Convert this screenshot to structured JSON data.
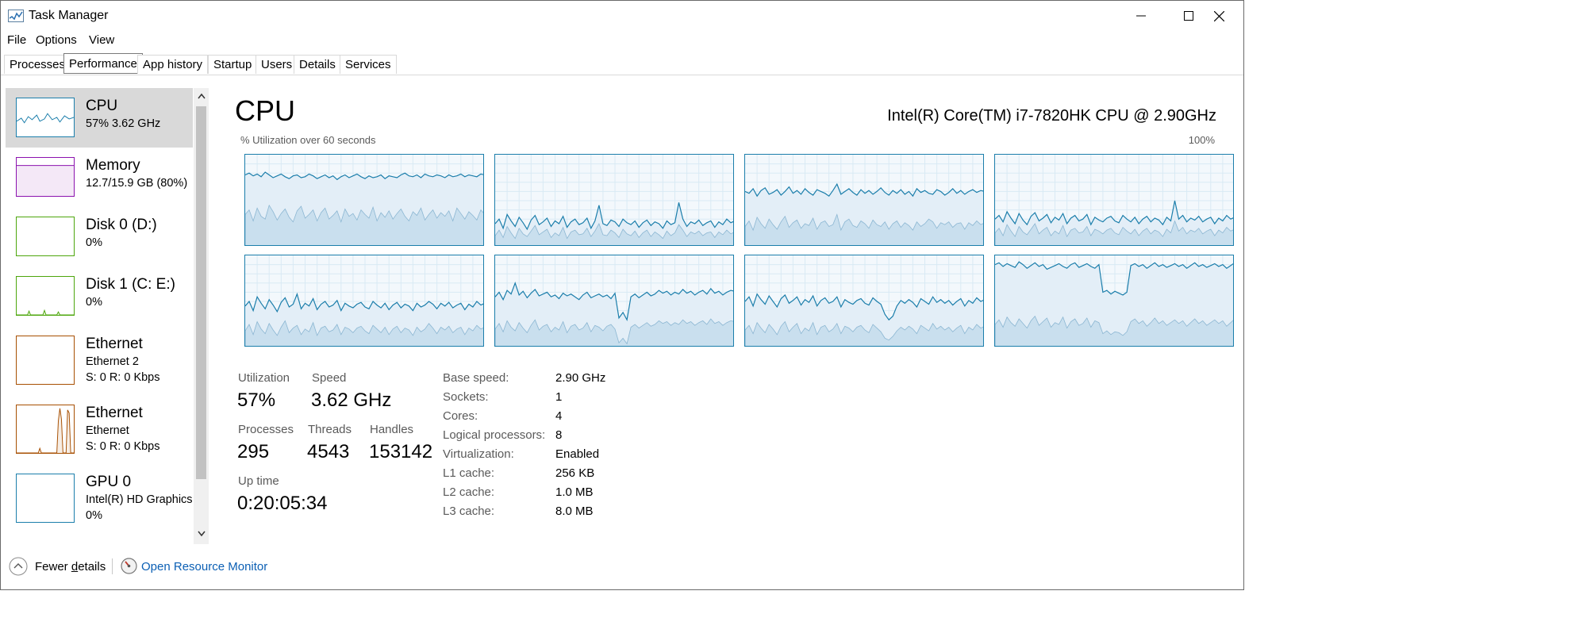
{
  "window": {
    "title": "Task Manager"
  },
  "menu": [
    "File",
    "Options",
    "View"
  ],
  "tabs": [
    "Processes",
    "Performance",
    "App history",
    "Startup",
    "Users",
    "Details",
    "Services"
  ],
  "active_tab": "Performance",
  "sidebar": [
    {
      "title": "CPU",
      "sub1": "57%  3.62 GHz",
      "sub2": "",
      "color": "#1b7eab",
      "selected": true
    },
    {
      "title": "Memory",
      "sub1": "12.7/15.9 GB (80%)",
      "sub2": "",
      "color": "#8b12ae",
      "selected": false
    },
    {
      "title": "Disk 0 (D:)",
      "sub1": "0%",
      "sub2": "",
      "color": "#4da60c",
      "selected": false
    },
    {
      "title": "Disk 1 (C: E:)",
      "sub1": "0%",
      "sub2": "",
      "color": "#4da60c",
      "selected": false
    },
    {
      "title": "Ethernet",
      "sub1": "Ethernet 2",
      "sub2": "S: 0  R: 0 Kbps",
      "color": "#a74f01",
      "selected": false
    },
    {
      "title": "Ethernet",
      "sub1": "Ethernet",
      "sub2": "S: 0  R: 0 Kbps",
      "color": "#a74f01",
      "selected": false
    },
    {
      "title": "GPU 0",
      "sub1": "Intel(R) HD Graphics",
      "sub2": "0%",
      "color": "#1b7eab",
      "selected": false
    }
  ],
  "cpu": {
    "title": "CPU",
    "model": "Intel(R) Core(TM) i7-7820HK CPU @ 2.90GHz",
    "graph_caption": "% Utilization over 60 seconds",
    "graph_max": "100%",
    "stats": {
      "utilization_label": "Utilization",
      "utilization": "57%",
      "speed_label": "Speed",
      "speed": "3.62 GHz",
      "processes_label": "Processes",
      "processes": "295",
      "threads_label": "Threads",
      "threads": "4543",
      "handles_label": "Handles",
      "handles": "153142",
      "uptime_label": "Up time",
      "uptime": "0:20:05:34"
    },
    "info": [
      {
        "label": "Base speed:",
        "value": "2.90 GHz"
      },
      {
        "label": "Sockets:",
        "value": "1"
      },
      {
        "label": "Cores:",
        "value": "4"
      },
      {
        "label": "Logical processors:",
        "value": "8"
      },
      {
        "label": "Virtualization:",
        "value": "Enabled"
      },
      {
        "label": "L1 cache:",
        "value": "256 KB"
      },
      {
        "label": "L2 cache:",
        "value": "1.0 MB"
      },
      {
        "label": "L3 cache:",
        "value": "8.0 MB"
      }
    ],
    "graph_color": "#1b7eab",
    "cores": [
      {
        "util": [
          78,
          80,
          77,
          79,
          76,
          81,
          78,
          75,
          77,
          79,
          76,
          74,
          77,
          78,
          75,
          76,
          79,
          77,
          74,
          76,
          78,
          75,
          77,
          73,
          76,
          78,
          75,
          77,
          79,
          76,
          74,
          77,
          75,
          76,
          78,
          74,
          77,
          76,
          75,
          78,
          80,
          77,
          76,
          78,
          75,
          79,
          77,
          76,
          78,
          77,
          75,
          78,
          76,
          77,
          79,
          76,
          78,
          77,
          76,
          79,
          78
        ],
        "kernel": [
          35,
          40,
          28,
          42,
          33,
          30,
          45,
          38,
          29,
          36,
          41,
          32,
          27,
          39,
          44,
          31,
          35,
          40,
          28,
          37,
          42,
          30,
          34,
          39,
          27,
          41,
          33,
          36,
          29,
          40,
          35,
          31,
          43,
          28,
          37,
          32,
          39,
          30,
          36,
          41,
          33,
          28,
          38,
          34,
          42,
          29,
          35,
          40,
          31,
          37,
          33,
          39,
          28,
          42,
          36,
          30,
          38,
          34,
          29,
          40,
          35
        ]
      },
      {
        "util": [
          25,
          30,
          20,
          35,
          28,
          22,
          32,
          26,
          19,
          29,
          34,
          24,
          27,
          31,
          22,
          28,
          25,
          33,
          21,
          27,
          30,
          24,
          26,
          31,
          20,
          28,
          45,
          25,
          23,
          29,
          27,
          22,
          30,
          26,
          24,
          28,
          21,
          26,
          29,
          23,
          27,
          25,
          20,
          28,
          24,
          26,
          48,
          30,
          22,
          27,
          25,
          29,
          23,
          26,
          28,
          21,
          27,
          24,
          30,
          26,
          28
        ],
        "kernel": [
          12,
          18,
          10,
          22,
          15,
          9,
          20,
          14,
          11,
          17,
          23,
          13,
          16,
          19,
          10,
          15,
          12,
          21,
          9,
          16,
          18,
          13,
          14,
          20,
          11,
          17,
          25,
          13,
          12,
          18,
          15,
          10,
          19,
          14,
          12,
          17,
          10,
          15,
          18,
          11,
          16,
          13,
          9,
          17,
          12,
          15,
          24,
          18,
          11,
          16,
          14,
          17,
          12,
          15,
          16,
          10,
          16,
          13,
          18,
          14,
          16
        ]
      },
      {
        "util": [
          60,
          58,
          63,
          55,
          61,
          64,
          57,
          59,
          62,
          56,
          60,
          65,
          58,
          61,
          57,
          63,
          59,
          56,
          62,
          60,
          58,
          55,
          61,
          68,
          57,
          60,
          63,
          59,
          56,
          62,
          58,
          61,
          57,
          60,
          64,
          59,
          56,
          61,
          58,
          62,
          57,
          60,
          55,
          63,
          59,
          61,
          58,
          57,
          62,
          60,
          56,
          59,
          63,
          58,
          61,
          57,
          60,
          62,
          59,
          61,
          60
        ],
        "kernel": [
          22,
          28,
          18,
          32,
          25,
          20,
          30,
          24,
          19,
          27,
          33,
          21,
          26,
          29,
          20,
          25,
          23,
          31,
          19,
          26,
          28,
          22,
          24,
          35,
          18,
          27,
          30,
          23,
          21,
          28,
          25,
          20,
          29,
          24,
          22,
          27,
          19,
          25,
          28,
          21,
          26,
          23,
          18,
          27,
          22,
          25,
          30,
          27,
          20,
          26,
          24,
          27,
          21,
          25,
          26,
          19,
          26,
          23,
          28,
          24,
          26
        ]
      },
      {
        "util": [
          30,
          34,
          27,
          38,
          31,
          25,
          36,
          29,
          24,
          33,
          37,
          28,
          31,
          35,
          26,
          32,
          29,
          36,
          25,
          31,
          34,
          28,
          30,
          35,
          24,
          32,
          29,
          27,
          31,
          33,
          28,
          26,
          34,
          30,
          27,
          32,
          25,
          30,
          33,
          27,
          31,
          29,
          24,
          32,
          28,
          50,
          30,
          34,
          27,
          31,
          29,
          33,
          27,
          30,
          32,
          25,
          31,
          28,
          34,
          30,
          32
        ],
        "kernel": [
          15,
          20,
          12,
          24,
          17,
          11,
          22,
          16,
          13,
          19,
          25,
          14,
          18,
          21,
          12,
          17,
          14,
          23,
          11,
          18,
          20,
          15,
          16,
          22,
          12,
          19,
          17,
          14,
          18,
          20,
          15,
          13,
          21,
          17,
          14,
          19,
          12,
          17,
          20,
          14,
          18,
          16,
          11,
          19,
          15,
          28,
          17,
          21,
          14,
          18,
          16,
          20,
          14,
          17,
          19,
          12,
          18,
          15,
          21,
          17,
          19
        ]
      },
      {
        "util": [
          45,
          50,
          40,
          55,
          48,
          42,
          52,
          46,
          39,
          49,
          54,
          44,
          47,
          58,
          42,
          48,
          45,
          53,
          41,
          47,
          50,
          44,
          46,
          51,
          40,
          48,
          45,
          43,
          47,
          49,
          44,
          42,
          50,
          46,
          43,
          48,
          41,
          46,
          49,
          43,
          47,
          45,
          40,
          48,
          44,
          46,
          50,
          47,
          42,
          48,
          45,
          49,
          43,
          46,
          48,
          41,
          47,
          44,
          50,
          46,
          48
        ],
        "kernel": [
          18,
          25,
          14,
          28,
          20,
          15,
          26,
          19,
          13,
          22,
          29,
          16,
          21,
          24,
          14,
          20,
          17,
          27,
          13,
          21,
          23,
          17,
          19,
          25,
          14,
          22,
          20,
          16,
          21,
          23,
          18,
          15,
          24,
          20,
          16,
          22,
          14,
          20,
          23,
          16,
          21,
          19,
          13,
          22,
          17,
          20,
          26,
          21,
          15,
          22,
          19,
          23,
          16,
          20,
          22,
          14,
          21,
          18,
          24,
          20,
          22
        ]
      },
      {
        "util": [
          55,
          60,
          52,
          62,
          58,
          70,
          57,
          61,
          54,
          59,
          63,
          56,
          58,
          60,
          55,
          57,
          53,
          59,
          56,
          58,
          55,
          52,
          57,
          60,
          54,
          56,
          58,
          55,
          57,
          53,
          59,
          32,
          38,
          30,
          55,
          58,
          54,
          57,
          60,
          56,
          58,
          62,
          59,
          61,
          57,
          60,
          58,
          63,
          59,
          61,
          57,
          60,
          62,
          58,
          64,
          59,
          61,
          57,
          60,
          62,
          61
        ],
        "kernel": [
          20,
          26,
          17,
          29,
          22,
          18,
          27,
          21,
          16,
          24,
          30,
          19,
          23,
          25,
          17,
          22,
          19,
          28,
          16,
          23,
          25,
          19,
          21,
          27,
          17,
          24,
          22,
          18,
          23,
          25,
          20,
          5,
          10,
          4,
          22,
          25,
          21,
          24,
          27,
          23,
          25,
          29,
          26,
          28,
          24,
          27,
          25,
          30,
          26,
          28,
          24,
          27,
          29,
          25,
          31,
          26,
          28,
          24,
          27,
          29,
          28
        ]
      },
      {
        "util": [
          50,
          55,
          45,
          58,
          52,
          47,
          56,
          50,
          44,
          53,
          57,
          48,
          51,
          55,
          46,
          52,
          49,
          56,
          45,
          51,
          54,
          48,
          50,
          55,
          44,
          52,
          49,
          47,
          51,
          53,
          48,
          46,
          54,
          50,
          47,
          36,
          30,
          34,
          45,
          51,
          48,
          52,
          49,
          44,
          53,
          50,
          47,
          55,
          49,
          52,
          48,
          51,
          46,
          50,
          53,
          45,
          51,
          48,
          54,
          50,
          52
        ],
        "kernel": [
          19,
          24,
          15,
          27,
          21,
          16,
          25,
          20,
          14,
          23,
          28,
          17,
          22,
          26,
          15,
          21,
          18,
          27,
          14,
          22,
          24,
          17,
          20,
          26,
          15,
          23,
          21,
          17,
          22,
          24,
          19,
          16,
          25,
          21,
          17,
          10,
          8,
          12,
          18,
          22,
          19,
          23,
          20,
          15,
          24,
          21,
          18,
          26,
          20,
          23,
          19,
          22,
          17,
          21,
          24,
          15,
          22,
          19,
          25,
          21,
          23
        ]
      },
      {
        "util": [
          90,
          92,
          88,
          91,
          89,
          87,
          93,
          90,
          86,
          89,
          92,
          88,
          90,
          85,
          87,
          89,
          91,
          88,
          86,
          90,
          92,
          87,
          89,
          91,
          88,
          86,
          90,
          60,
          62,
          58,
          61,
          59,
          57,
          60,
          89,
          91,
          88,
          90,
          86,
          89,
          92,
          88,
          90,
          87,
          89,
          91,
          88,
          90,
          86,
          89,
          92,
          88,
          90,
          87,
          89,
          91,
          88,
          90,
          86,
          89,
          92
        ],
        "kernel": [
          25,
          30,
          22,
          33,
          27,
          23,
          31,
          26,
          21,
          29,
          34,
          24,
          28,
          32,
          22,
          27,
          25,
          33,
          21,
          28,
          31,
          24,
          26,
          32,
          22,
          29,
          27,
          15,
          18,
          14,
          17,
          16,
          13,
          17,
          28,
          31,
          26,
          29,
          23,
          27,
          32,
          26,
          29,
          24,
          27,
          30,
          26,
          29,
          23,
          27,
          31,
          26,
          29,
          24,
          27,
          30,
          26,
          29,
          23,
          27,
          31
        ]
      }
    ]
  }
}
